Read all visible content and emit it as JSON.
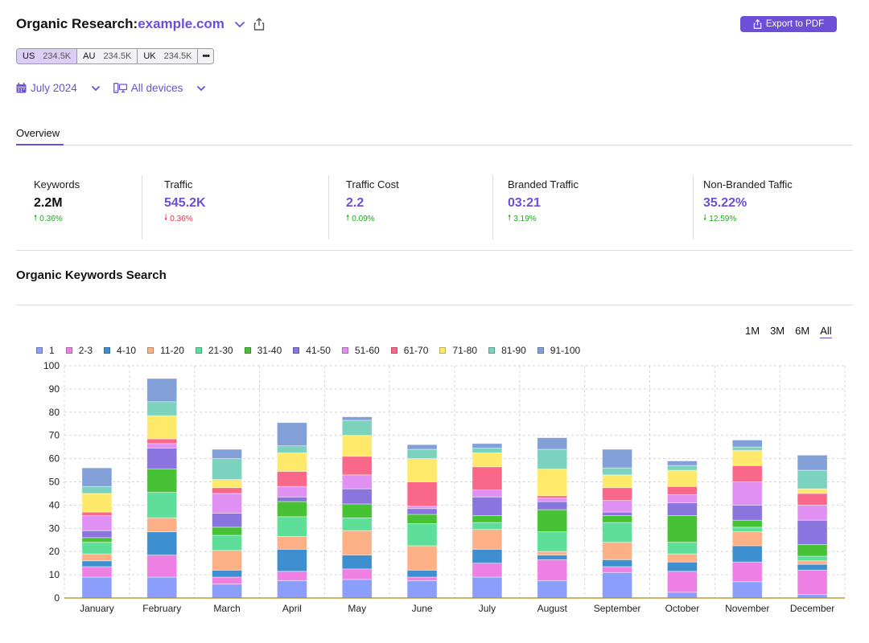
{
  "header": {
    "title_prefix": "Organic Research:",
    "domain": "example.com",
    "icons": {
      "dropdown": "chevron-down-icon",
      "share": "share-icon"
    }
  },
  "export_button": {
    "label": "Export to PDF",
    "icon": "share-icon"
  },
  "databases": [
    {
      "code": "US",
      "count": "234.5K",
      "active": true
    },
    {
      "code": "AU",
      "count": "234.5K",
      "active": false
    },
    {
      "code": "UK",
      "count": "234.5K",
      "active": false
    }
  ],
  "databases_more": "•••",
  "filters": {
    "date": {
      "label": "July 2024",
      "icon": "calendar-icon"
    },
    "device": {
      "label": "All devices",
      "icon": "devices-icon"
    }
  },
  "tabs": [
    {
      "label": "Overview",
      "active": true
    }
  ],
  "metrics": [
    {
      "label": "Keywords",
      "value": "2.2M",
      "delta": "0.36%",
      "direction": "up",
      "value_color": "dark",
      "delta_color": "up"
    },
    {
      "label": "Traffic",
      "value": "545.2K",
      "delta": "0.36%",
      "direction": "down",
      "value_color": "purple",
      "delta_color": "down"
    },
    {
      "label": "Traffic Cost",
      "value": "2.2",
      "delta": "0.09%",
      "direction": "up",
      "value_color": "purple",
      "delta_color": "up"
    },
    {
      "label": "Branded Traffic",
      "value": "03:21",
      "delta": "3.19%",
      "direction": "up",
      "value_color": "purple",
      "delta_color": "up"
    },
    {
      "label": "Non-Branded Taffic",
      "value": "35.22%",
      "delta": "12.59%",
      "direction": "down",
      "value_color": "purple",
      "delta_color": "up"
    }
  ],
  "section_title": "Organic Keywords Search",
  "range_options": [
    {
      "label": "1M",
      "active": false
    },
    {
      "label": "3M",
      "active": false
    },
    {
      "label": "6M",
      "active": false
    },
    {
      "label": "All",
      "active": true
    }
  ],
  "colors": {
    "accent": "#6c4fd6",
    "up": "#1fa81f",
    "down": "#e5334b",
    "axis": "#b8860b"
  },
  "chart_data": {
    "type": "bar",
    "stacked": true,
    "title": "Organic Keywords Search",
    "xlabel": "",
    "ylabel": "",
    "ylim": [
      0,
      100
    ],
    "yticks": [
      0,
      10,
      20,
      30,
      40,
      50,
      60,
      70,
      80,
      90,
      100
    ],
    "grid": true,
    "legend_position": "top-left",
    "categories": [
      "January",
      "February",
      "March",
      "April",
      "May",
      "June",
      "July",
      "August",
      "September",
      "October",
      "November",
      "December"
    ],
    "series": [
      {
        "name": "1",
        "color": "#8c9efc",
        "values": [
          9,
          9,
          6,
          7.5,
          8,
          7.5,
          9,
          7.5,
          11,
          2.5,
          7,
          1.5
        ]
      },
      {
        "name": "2-3",
        "color": "#ef80e3",
        "values": [
          4.5,
          9.5,
          3,
          4,
          4.5,
          1.5,
          6,
          9,
          2.5,
          9,
          8.5,
          10.5
        ]
      },
      {
        "name": "4-10",
        "color": "#3e8fd0",
        "values": [
          2.5,
          10,
          3,
          9.5,
          6,
          3,
          6,
          2,
          3,
          4,
          7,
          2.5
        ]
      },
      {
        "name": "11-20",
        "color": "#fdb086",
        "values": [
          3,
          6,
          8.5,
          5.5,
          10.5,
          10.5,
          8.5,
          1.5,
          7.5,
          3.5,
          6,
          1.5
        ]
      },
      {
        "name": "21-30",
        "color": "#5ddf9a",
        "values": [
          5,
          11,
          6.5,
          8.5,
          5.5,
          9.5,
          3,
          8.5,
          8.5,
          5,
          2,
          2
        ]
      },
      {
        "name": "31-40",
        "color": "#46c234",
        "values": [
          2,
          10,
          3.5,
          6.5,
          6,
          4,
          3,
          9.5,
          3,
          11.5,
          3,
          5
        ]
      },
      {
        "name": "41-50",
        "color": "#8a74de",
        "values": [
          3,
          9,
          6,
          2,
          6.5,
          2.5,
          8,
          3.5,
          1.5,
          5.5,
          6.5,
          10.5
        ]
      },
      {
        "name": "51-60",
        "color": "#e08ff2",
        "values": [
          6.5,
          2,
          8.5,
          4.5,
          6,
          1,
          3,
          1.5,
          5,
          3.5,
          10,
          6.5
        ]
      },
      {
        "name": "61-70",
        "color": "#f96889",
        "values": [
          1.5,
          2,
          2.5,
          6.5,
          8,
          10.5,
          10,
          1,
          5.5,
          3.5,
          7,
          5
        ]
      },
      {
        "name": "71-80",
        "color": "#ffe96a",
        "values": [
          8,
          10,
          3.5,
          8,
          9,
          10,
          6,
          11.5,
          5.5,
          7,
          6.5,
          2
        ]
      },
      {
        "name": "81-90",
        "color": "#7bd2bd",
        "values": [
          3,
          6,
          9,
          3,
          6.5,
          4,
          2,
          8.5,
          3,
          2,
          1.5,
          8
        ]
      },
      {
        "name": "91-100",
        "color": "#829fd8",
        "values": [
          8,
          10,
          4,
          10,
          1.5,
          2,
          2,
          5,
          8,
          2,
          3,
          6.5
        ]
      }
    ]
  }
}
